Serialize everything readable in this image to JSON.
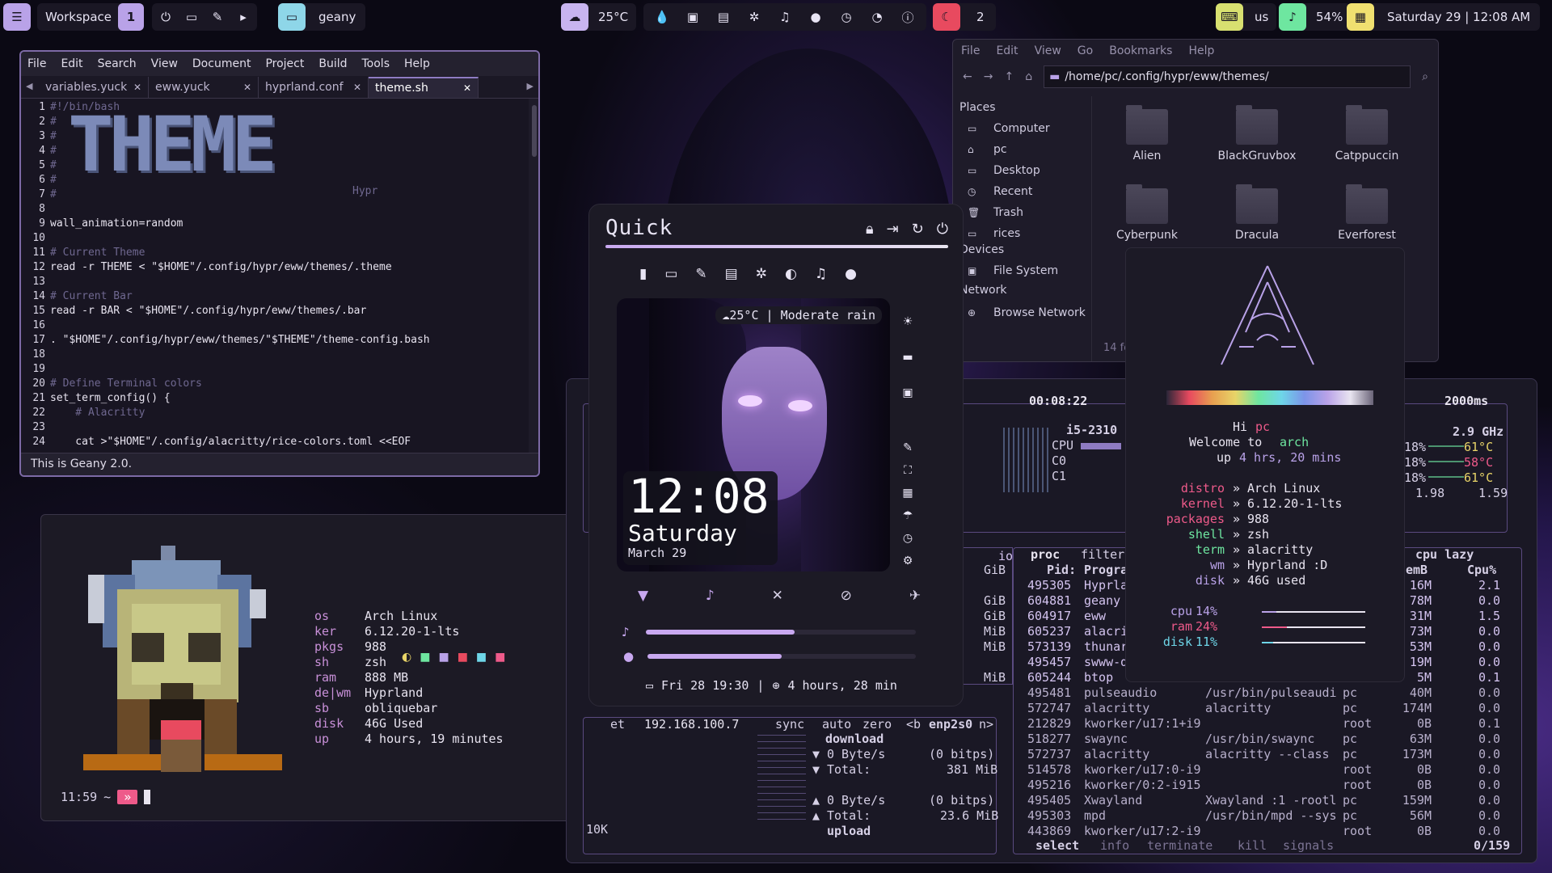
{
  "topbar": {
    "workspace_label": "Workspace",
    "workspace_num": "1",
    "active_app": "geany",
    "temperature": "25°C",
    "notif_count": "2",
    "keyboard": "us",
    "volume": "54%",
    "datetime": "Saturday 29 | 12:08 AM"
  },
  "geany": {
    "menus": [
      "File",
      "Edit",
      "Search",
      "View",
      "Document",
      "Project",
      "Build",
      "Tools",
      "Help"
    ],
    "tabs": [
      "variables.yuck",
      "eww.yuck",
      "hyprland.conf",
      "theme.sh"
    ],
    "tab_close": "✕",
    "banner": "THEME",
    "banner_sub": "Hypr",
    "lines": [
      {
        "n": "1",
        "t": "#!/bin/bash",
        "c": "cm"
      },
      {
        "n": "2",
        "t": "#",
        "c": "cm"
      },
      {
        "n": "3",
        "t": "#",
        "c": "cm"
      },
      {
        "n": "4",
        "t": "#",
        "c": "cm"
      },
      {
        "n": "5",
        "t": "#",
        "c": "cm"
      },
      {
        "n": "6",
        "t": "#",
        "c": "cm"
      },
      {
        "n": "7",
        "t": "#",
        "c": "cm"
      },
      {
        "n": "8",
        "t": "",
        "c": ""
      },
      {
        "n": "9",
        "t": "wall_animation=random",
        "c": ""
      },
      {
        "n": "10",
        "t": "",
        "c": ""
      },
      {
        "n": "11",
        "t": "# Current Theme",
        "c": "cm"
      },
      {
        "n": "12",
        "t": "read -r THEME < \"$HOME\"/.config/hypr/eww/themes/.theme",
        "c": ""
      },
      {
        "n": "13",
        "t": "",
        "c": ""
      },
      {
        "n": "14",
        "t": "# Current Bar",
        "c": "cm"
      },
      {
        "n": "15",
        "t": "read -r BAR < \"$HOME\"/.config/hypr/eww/themes/.bar",
        "c": ""
      },
      {
        "n": "16",
        "t": "",
        "c": ""
      },
      {
        "n": "17",
        "t": ". \"$HOME\"/.config/hypr/eww/themes/\"$THEME\"/theme-config.bash",
        "c": ""
      },
      {
        "n": "18",
        "t": "",
        "c": ""
      },
      {
        "n": "19",
        "t": "",
        "c": ""
      },
      {
        "n": "20",
        "t": "# Define Terminal colors",
        "c": "cm"
      },
      {
        "n": "21",
        "t": "set_term_config() {",
        "c": ""
      },
      {
        "n": "22",
        "t": "    # Alacritty",
        "c": "cm"
      },
      {
        "n": "23",
        "t": "",
        "c": ""
      },
      {
        "n": "24",
        "t": "    cat >\"$HOME\"/.config/alacritty/rice-colors.toml <<EOF",
        "c": ""
      }
    ],
    "status": "This is Geany 2.0."
  },
  "leftfetch": {
    "rows": [
      {
        "k": "os",
        "v": "Arch Linux"
      },
      {
        "k": "ker",
        "v": "6.12.20-1-lts"
      },
      {
        "k": "pkgs",
        "v": "988"
      },
      {
        "k": "sh",
        "v": "zsh"
      },
      {
        "k": "ram",
        "v": "888 MB"
      },
      {
        "k": "de|wm",
        "v": "Hyprland"
      },
      {
        "k": "sb",
        "v": "obliquebar"
      },
      {
        "k": "disk",
        "v": "46G Used"
      },
      {
        "k": "up",
        "v": "4 hours, 19 minutes"
      }
    ],
    "prompt_time": "11:59",
    "prompt_tilde": "~"
  },
  "quick": {
    "title": "Quick",
    "weather": "25°C | Moderate rain",
    "clock": "12:08",
    "day": "Saturday",
    "date": "March 29",
    "volume_level": 0.55,
    "mic_level": 0.5,
    "footer_date": "Fri 28 19:30",
    "footer_sep": "|",
    "footer_uptime": "4 hours, 28 min"
  },
  "filemanager": {
    "menus": [
      "File",
      "Edit",
      "View",
      "Go",
      "Bookmarks",
      "Help"
    ],
    "path": "/home/pc/.config/hypr/eww/themes/",
    "places_header": "Places",
    "places": [
      "Computer",
      "pc",
      "Desktop",
      "Recent",
      "Trash",
      "rices"
    ],
    "devices_header": "Devices",
    "devices": [
      "File System"
    ],
    "network_header": "Network",
    "network": [
      "Browse Network"
    ],
    "status": "14 fo",
    "folders": [
      "Alien",
      "BlackGruvbox",
      "Catppuccin",
      "Cyberpunk",
      "Dracula",
      "Everforest"
    ]
  },
  "btop": {
    "uptime": "00:08:22",
    "interval": "2000ms",
    "cpu_name": "i5-2310",
    "cpu_freq": "2.9 GHz",
    "cpu_label": "CPU",
    "cores": [
      "C0",
      "C1"
    ],
    "core_pcts": [
      "18%",
      "18%",
      "18%"
    ],
    "temps": [
      "61°C",
      "58°C",
      "61°C"
    ],
    "load": [
      "1.98",
      "1.59"
    ],
    "net_ip": "192.168.100.7",
    "net_labels": {
      "sync": "sync",
      "auto": "auto",
      "zero": "zero",
      "b": "<b",
      "iface": "enp2s0",
      "n": "n>"
    },
    "download_label": "download",
    "upload_label": "upload",
    "dl_rate": "0 Byte/s",
    "dl_bits": "(0 bitps)",
    "dl_total": "381 MiB",
    "ul_rate": "0 Byte/s",
    "ul_bits": "(0 bitps)",
    "ul_total": "23.6 MiB",
    "total_label": "Total:",
    "net_scale": "10K",
    "et": "et",
    "mem_labels": [
      "GiB",
      "GiB",
      "GiB",
      "MiB",
      "MiB",
      "MiB"
    ],
    "io": "io",
    "proc_header": "proc",
    "filter": "filter",
    "cpu_lazy": "cpu lazy",
    "cols": {
      "pid": "Pid:",
      "prog": "Program",
      "mem": "emB",
      "cpu": "Cpu%"
    },
    "procs": [
      {
        "pid": "495305",
        "prog": "Hyprla",
        "cmd": "",
        "user": "",
        "mem": "16M",
        "cpu": "2.1"
      },
      {
        "pid": "604881",
        "prog": "geany",
        "cmd": "",
        "user": "",
        "mem": "78M",
        "cpu": "0.0"
      },
      {
        "pid": "604917",
        "prog": "eww",
        "cmd": "",
        "user": "",
        "mem": "31M",
        "cpu": "1.5"
      },
      {
        "pid": "605237",
        "prog": "alacri",
        "cmd": "",
        "user": "",
        "mem": "73M",
        "cpu": "0.0"
      },
      {
        "pid": "573139",
        "prog": "thunar",
        "cmd": "",
        "user": "",
        "mem": "53M",
        "cpu": "0.0"
      },
      {
        "pid": "495457",
        "prog": "swww-d",
        "cmd": "",
        "user": "",
        "mem": "19M",
        "cpu": "0.0"
      },
      {
        "pid": "605244",
        "prog": "btop",
        "cmd": "",
        "user": "",
        "mem": "5M",
        "cpu": "0.1"
      },
      {
        "pid": "495481",
        "prog": "pulseaudio",
        "cmd": "/usr/bin/pulseaudi",
        "user": "pc",
        "mem": "40M",
        "cpu": "0.0"
      },
      {
        "pid": "572747",
        "prog": "alacritty",
        "cmd": "alacritty",
        "user": "pc",
        "mem": "174M",
        "cpu": "0.0"
      },
      {
        "pid": "212829",
        "prog": "kworker/u17:1+i9",
        "cmd": "",
        "user": "root",
        "mem": "0B",
        "cpu": "0.1"
      },
      {
        "pid": "518277",
        "prog": "swaync",
        "cmd": "/usr/bin/swaync",
        "user": "pc",
        "mem": "63M",
        "cpu": "0.0"
      },
      {
        "pid": "572737",
        "prog": "alacritty",
        "cmd": "alacritty --class",
        "user": "pc",
        "mem": "173M",
        "cpu": "0.0"
      },
      {
        "pid": "514578",
        "prog": "kworker/u17:0-i9",
        "cmd": "",
        "user": "root",
        "mem": "0B",
        "cpu": "0.0"
      },
      {
        "pid": "495216",
        "prog": "kworker/0:2-i915",
        "cmd": "",
        "user": "root",
        "mem": "0B",
        "cpu": "0.0"
      },
      {
        "pid": "495405",
        "prog": "Xwayland",
        "cmd": "Xwayland :1 -rootl",
        "user": "pc",
        "mem": "159M",
        "cpu": "0.0"
      },
      {
        "pid": "495303",
        "prog": "mpd",
        "cmd": "/usr/bin/mpd --sys",
        "user": "pc",
        "mem": "56M",
        "cpu": "0.0"
      },
      {
        "pid": "443869",
        "prog": "kworker/u17:2-i9",
        "cmd": "",
        "user": "root",
        "mem": "0B",
        "cpu": "0.0"
      }
    ],
    "footer": {
      "select": "select",
      "info": "info",
      "terminate": "terminate",
      "kill": "kill",
      "signals": "signals",
      "count": "0/159"
    }
  },
  "neofetch": {
    "hi": "Hi",
    "user": "pc",
    "welcome": "Welcome to",
    "distro_name": "arch",
    "up_label": "up",
    "uptime": "4 hrs, 20 mins",
    "rows": [
      {
        "k": "distro",
        "v": "Arch Linux"
      },
      {
        "k": "kernel",
        "v": "6.12.20-1-lts"
      },
      {
        "k": "packages",
        "v": "988"
      },
      {
        "k": "shell",
        "v": "zsh"
      },
      {
        "k": "term",
        "v": "alacritty"
      },
      {
        "k": "wm",
        "v": "Hyprland :D"
      },
      {
        "k": "disk",
        "v": "46G used"
      }
    ],
    "sep": "»",
    "meters": [
      {
        "k": "cpu",
        "v": "14%",
        "level": 0.14
      },
      {
        "k": "ram",
        "v": "24%",
        "level": 0.24
      },
      {
        "k": "disk",
        "v": "11%",
        "level": 0.11
      }
    ]
  },
  "colors": {
    "accent": "#8e7bc2",
    "pink": "#ee5a8a",
    "green": "#6ee6a0",
    "yellow": "#e8d468",
    "red": "#e84a5f"
  }
}
